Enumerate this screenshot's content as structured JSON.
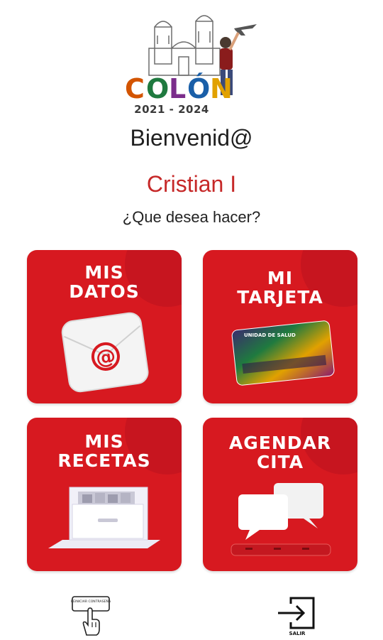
{
  "logo": {
    "text": "COLÓN",
    "years": "2021 - 2024"
  },
  "welcome": "Bienvenid@",
  "user_name": "Cristian I",
  "prompt": "¿Que desea hacer?",
  "tiles": [
    {
      "line1": "MIS",
      "line2": "DATOS"
    },
    {
      "line1": "MI",
      "line2": "TARJETA",
      "card_text": "UNIDAD DE SALUD"
    },
    {
      "line1": "MIS",
      "line2": "RECETAS"
    },
    {
      "line1": "AGENDAR",
      "line2": "CITA"
    }
  ],
  "bottom": {
    "reset_password_label": "REINICIAR CONTRASEÑA",
    "logout_label": "SALIR"
  },
  "colors": {
    "accent": "#d71920",
    "user_name": "#c62828"
  }
}
